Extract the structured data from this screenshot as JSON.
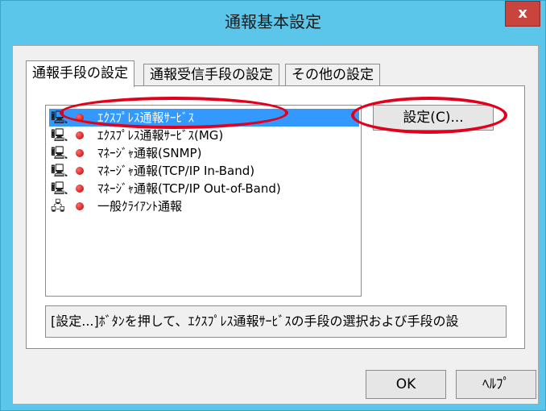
{
  "window": {
    "title": "通報基本設定",
    "close_label": "x"
  },
  "tabs": [
    {
      "label": "通報手段の設定"
    },
    {
      "label": "通報受信手段の設定"
    },
    {
      "label": "その他の設定"
    }
  ],
  "list": {
    "items": [
      {
        "label": "ｴｸｽﾌﾟﾚｽ通報ｻｰﾋﾞｽ",
        "icon": "computer-icon",
        "selected": true
      },
      {
        "label": "ｴｸｽﾌﾟﾚｽ通報ｻｰﾋﾞｽ(MG)",
        "icon": "computer-icon"
      },
      {
        "label": "ﾏﾈｰｼﾞｬ通報(SNMP)",
        "icon": "computer-icon"
      },
      {
        "label": "ﾏﾈｰｼﾞｬ通報(TCP/IP In-Band)",
        "icon": "computer-icon"
      },
      {
        "label": "ﾏﾈｰｼﾞｬ通報(TCP/IP Out-of-Band)",
        "icon": "computer-icon"
      },
      {
        "label": "一般ｸﾗｲｱﾝﾄ通報",
        "icon": "network-icon"
      }
    ]
  },
  "buttons": {
    "settings": "設定(C)...",
    "ok": "OK",
    "help": "ﾍﾙﾌﾟ"
  },
  "hint": "[設定...]ﾎﾞﾀﾝを押して、ｴｸｽﾌﾟﾚｽ通報ｻｰﾋﾞｽの手段の選択および手段の設",
  "colors": {
    "titlebar": "#5cc6ea",
    "close": "#c9443d",
    "selection": "#3399ff",
    "annotation": "#e3001b"
  }
}
